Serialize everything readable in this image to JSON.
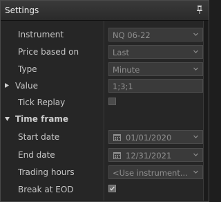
{
  "window": {
    "title": "Settings"
  },
  "properties": [
    {
      "label": "Instrument",
      "value": "NQ 06-22",
      "kind": "dropdown"
    },
    {
      "label": "Price based on",
      "value": "Last",
      "kind": "dropdown"
    },
    {
      "label": "Type",
      "value": "Minute",
      "kind": "dropdown"
    },
    {
      "label": "Value",
      "value": "1;3;1",
      "kind": "text"
    },
    {
      "label": "Tick Replay",
      "checked": false,
      "kind": "checkbox"
    }
  ],
  "time_frame": {
    "header": "Time frame",
    "start_date": {
      "label": "Start date",
      "value": "01/01/2020"
    },
    "end_date": {
      "label": "End date",
      "value": "12/31/2021"
    },
    "trading_hours": {
      "label": "Trading hours",
      "value": "<Use instrument..."
    },
    "break_at_eod": {
      "label": "Break at EOD",
      "checked": true
    }
  },
  "icons": {
    "pin": "pin-icon",
    "expand": "triangle-right-icon",
    "collapse": "triangle-down-icon",
    "calendar": "calendar-icon",
    "dropdown": "chevron-down-icon"
  },
  "colors": {
    "background": "#262626",
    "field": "#3a3a3a",
    "text": "#c6c6c6",
    "muted_text": "#8f8f8f"
  }
}
